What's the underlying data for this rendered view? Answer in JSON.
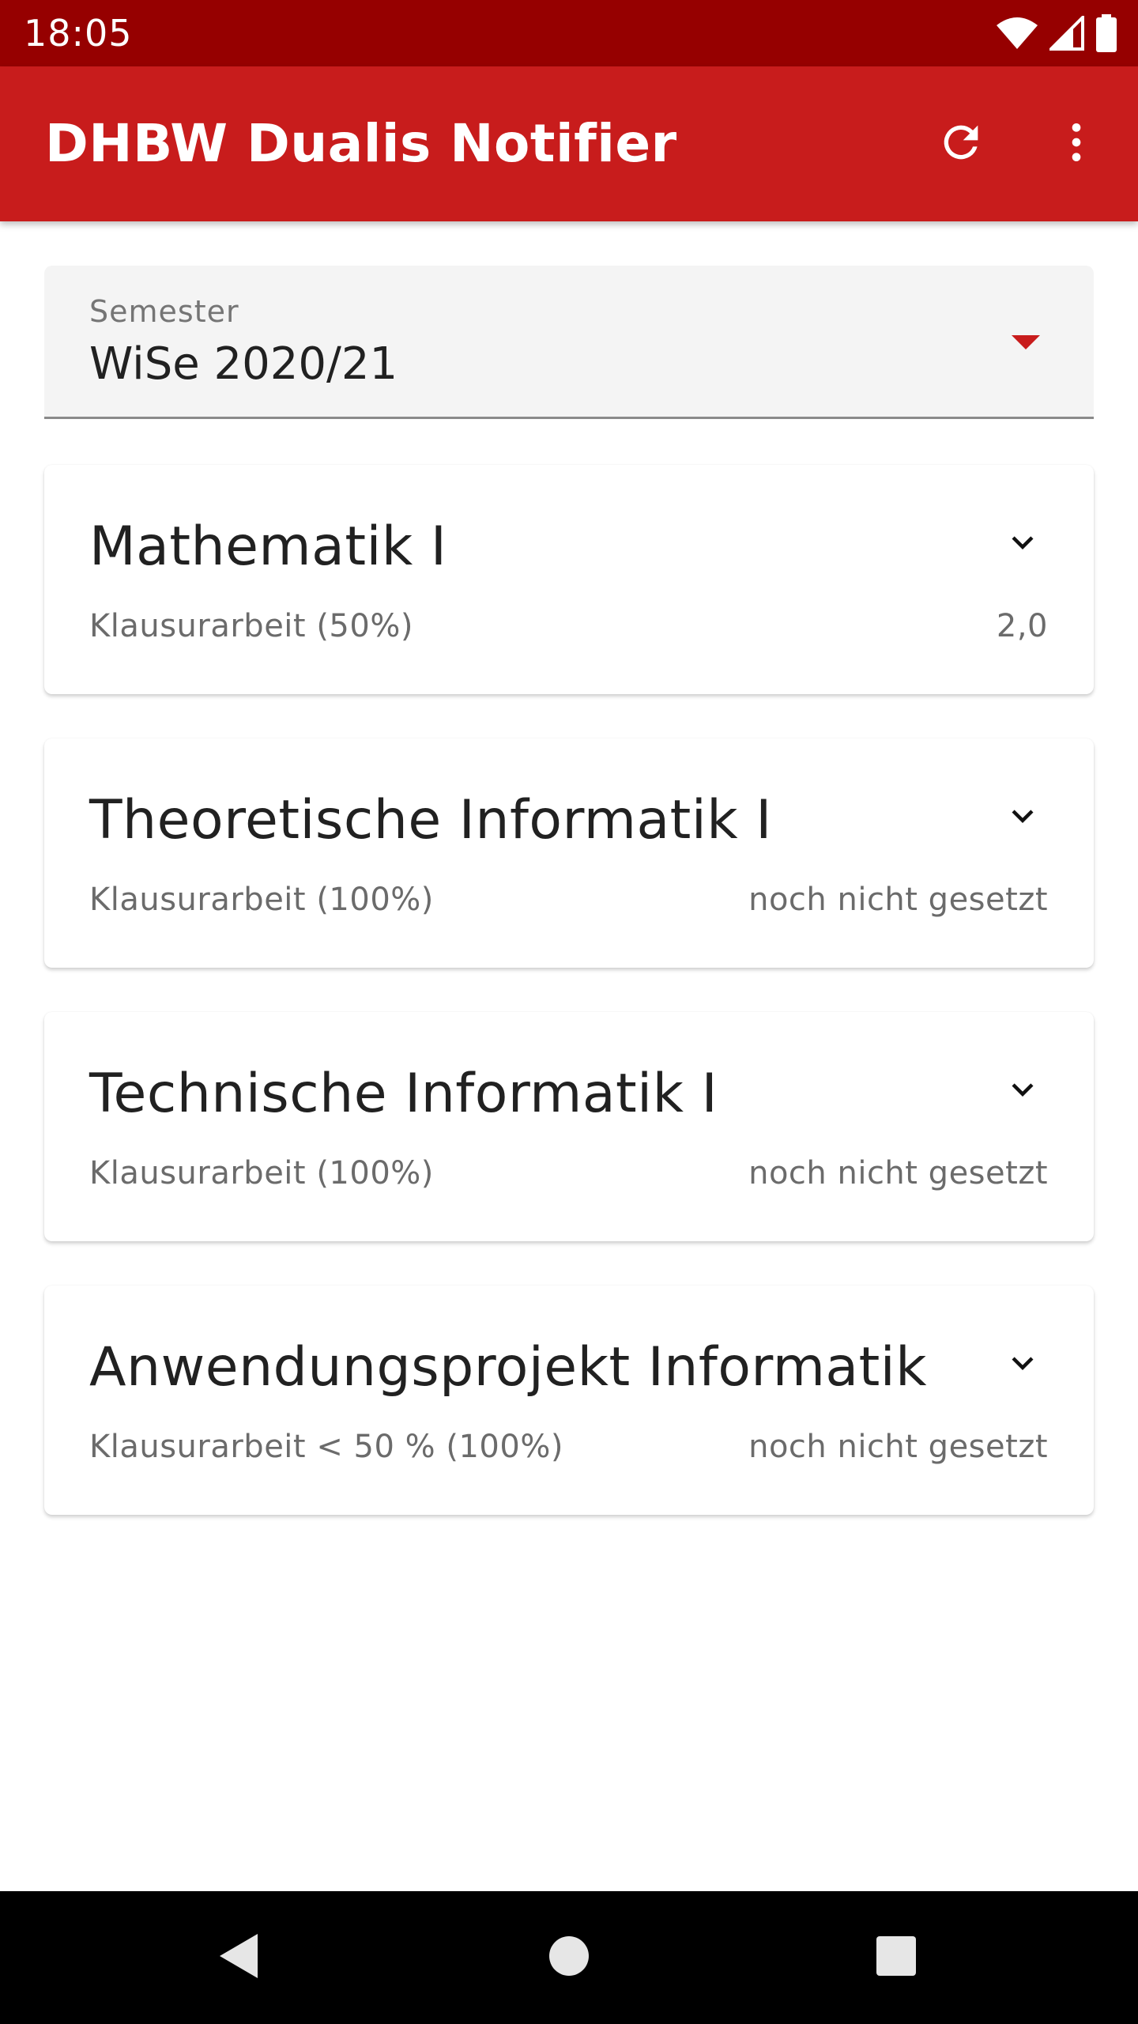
{
  "status_bar": {
    "time": "18:05",
    "icons": [
      "wifi-icon",
      "cell-signal-icon",
      "battery-icon"
    ]
  },
  "app_bar": {
    "title": "DHBW Dualis Notifier",
    "actions": [
      "refresh-icon",
      "more-vert-icon"
    ]
  },
  "semester": {
    "label": "Semester",
    "value": "WiSe 2020/21"
  },
  "modules": [
    {
      "title": "Mathematik I",
      "exam": "Klausurarbeit (50%)",
      "grade": "2,0"
    },
    {
      "title": "Theoretische Informatik I",
      "exam": "Klausurarbeit (100%)",
      "grade": "noch nicht gesetzt"
    },
    {
      "title": "Technische Informatik I",
      "exam": "Klausurarbeit (100%)",
      "grade": "noch nicht gesetzt"
    },
    {
      "title": "Anwendungsprojekt Informatik",
      "exam": "Klausurarbeit < 50 % (100%)",
      "grade": "noch nicht gesetzt"
    }
  ],
  "nav_bar": {
    "buttons": [
      "back-icon",
      "home-icon",
      "recents-icon"
    ]
  },
  "colors": {
    "status_bar": "#960000",
    "app_bar": "#c81c1c",
    "accent": "#c81c1c",
    "field_background": "#f4f4f4"
  }
}
